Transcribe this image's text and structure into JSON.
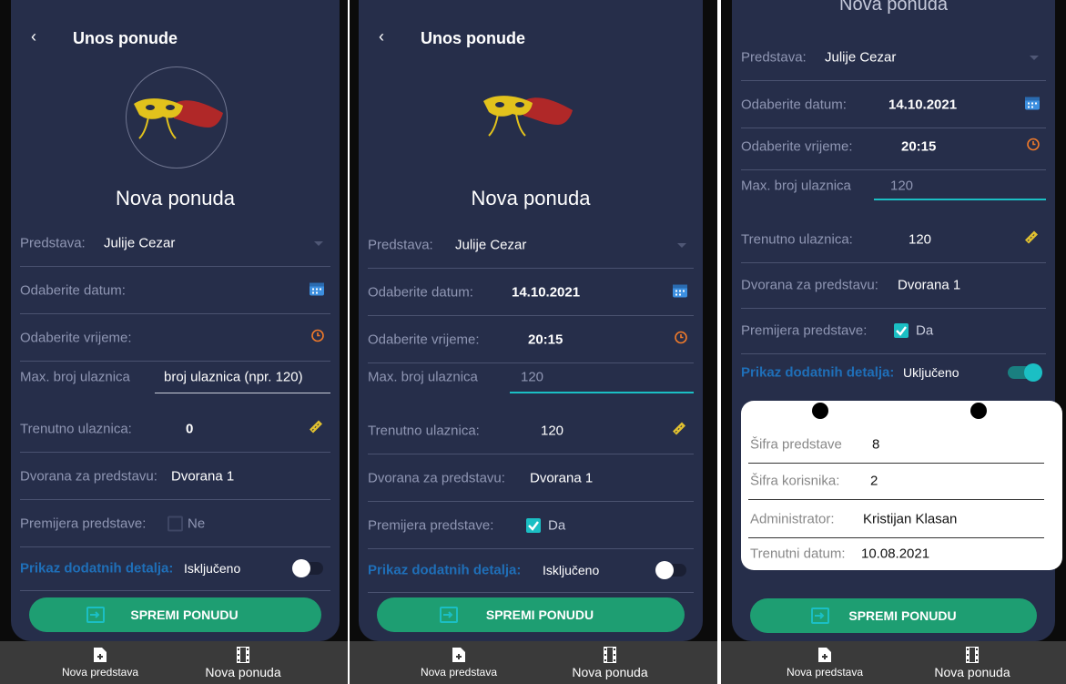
{
  "header": {
    "back_glyph": "‹",
    "title": "Unos ponude"
  },
  "form_title": "Nova ponuda",
  "labels": {
    "predstava": "Predstava:",
    "datum": "Odaberite datum:",
    "vrijeme": "Odaberite vrijeme:",
    "max": "Max. broj ulaznica",
    "trenutno": "Trenutno ulaznica:",
    "dvorana": "Dvorana za predstavu:",
    "premijera": "Premijera predstave:",
    "prikaz": "Prikaz dodatnih detalja:"
  },
  "screens": [
    {
      "predstava": "Julije Cezar",
      "datum": "",
      "vrijeme": "",
      "max_value": "",
      "max_placeholder": "broj ulaznica (npr. 120)",
      "trenutno": "0",
      "dvorana": "Dvorana 1",
      "premijera_checked": false,
      "premijera_text": "Ne",
      "prikaz_on": false,
      "prikaz_text": "Isključeno"
    },
    {
      "predstava": "Julije Cezar",
      "datum": "14.10.2021",
      "vrijeme": "20:15",
      "max_value": "120",
      "max_placeholder": "",
      "trenutno": "120",
      "dvorana": "Dvorana 1",
      "premijera_checked": true,
      "premijera_text": "Da",
      "prikaz_on": false,
      "prikaz_text": "Isključeno"
    },
    {
      "scrolled_title": "Nova ponuda",
      "predstava": "Julije Cezar",
      "datum": "14.10.2021",
      "vrijeme": "20:15",
      "max_value": "120",
      "max_placeholder": "",
      "trenutno": "120",
      "dvorana": "Dvorana 1",
      "premijera_checked": true,
      "premijera_text": "Da",
      "prikaz_on": true,
      "prikaz_text": "Uključeno",
      "details": {
        "sifra_predstave_label": "Šifra predstave",
        "sifra_predstave": "8",
        "sifra_korisnika_label": "Šifra korisnika:",
        "sifra_korisnika": "2",
        "administrator_label": "Administrator:",
        "administrator": "Kristijan Klasan",
        "trenutni_datum_label": "Trenutni datum:",
        "trenutni_datum": "10.08.2021"
      }
    }
  ],
  "save_button": "SPREMI PONUDU",
  "bottom_nav": [
    {
      "label": "Nova predstava",
      "icon": "add-file-icon"
    },
    {
      "label": "Nova ponuda",
      "icon": "film-icon"
    }
  ],
  "colors": {
    "card_bg": "#262e4a",
    "accent": "#1bbfc4",
    "button": "#1e9e72",
    "prikaz_label": "#1f6fb8",
    "clock": "#f07a2a",
    "calendar": "#3c8fe0",
    "ticket": "#e0c030"
  }
}
